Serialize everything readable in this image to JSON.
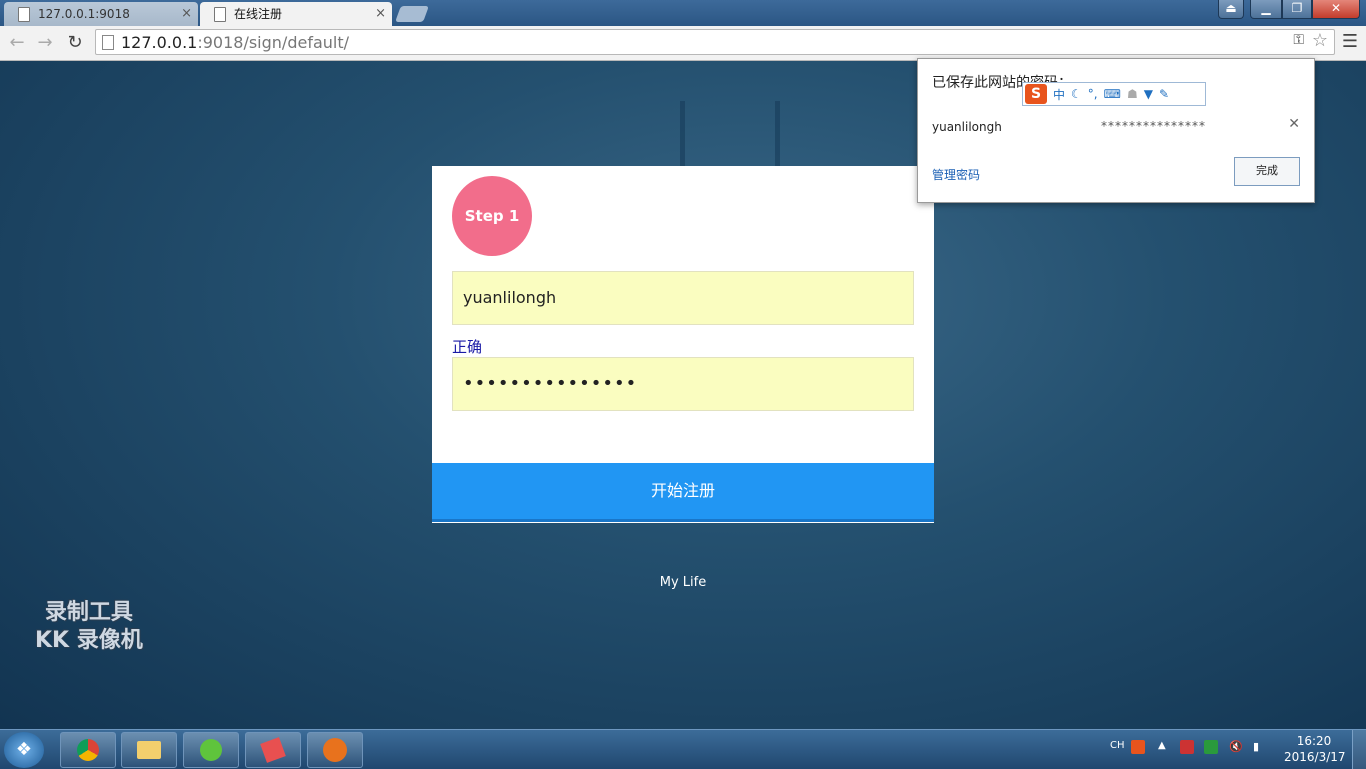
{
  "browser": {
    "tabs": [
      {
        "title": "127.0.0.1:9018"
      },
      {
        "title": "在线注册"
      }
    ],
    "url_host": "127.0.0.1",
    "url_rest": ":9018/sign/default/"
  },
  "form": {
    "step": "Step 1",
    "username": "yuanlilongh",
    "password_dots": "•••••••••••••••",
    "validation": "正确",
    "submit": "开始注册"
  },
  "footer": "My Life",
  "watermark": {
    "line1": "录制工具",
    "line2": "KK 录像机"
  },
  "password_popup": {
    "title": "已保存此网站的密码：",
    "username": "yuanlilongh",
    "password": "***************",
    "manage": "管理密码",
    "done": "完成"
  },
  "ime": {
    "logo": "S",
    "mode": "中"
  },
  "taskbar": {
    "lang": "CH",
    "time": "16:20",
    "date": "2016/3/17"
  }
}
